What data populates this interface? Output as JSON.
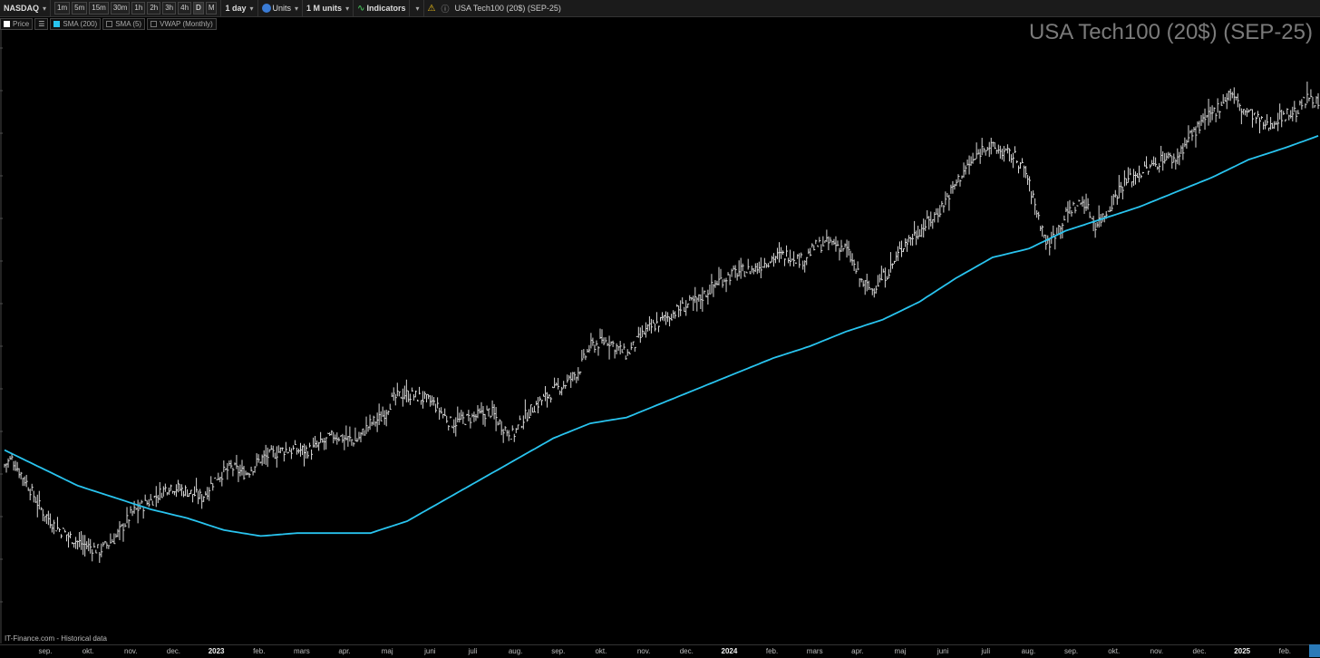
{
  "toolbar": {
    "exchange": "NASDAQ",
    "intervals": [
      "1m",
      "5m",
      "15m",
      "30m",
      "1h",
      "2h",
      "3h",
      "4h",
      "D",
      "M"
    ],
    "active_interval": "D",
    "period": "1 day",
    "units_label": "Units",
    "m_units": "1 M units",
    "indicators": "Indicators",
    "warning_icon": "warning-icon",
    "info_icon": "info-icon",
    "instrument": "USA Tech100 (20$) (SEP-25)"
  },
  "legend": {
    "price": "Price",
    "sma200": "SMA (200)",
    "sma5": "SMA (5)",
    "vwap": "VWAP (Monthly)",
    "sma200_color": "#29c4ef"
  },
  "footer": "IT-Finance.com - Historical data",
  "chart_data": {
    "type": "line",
    "title": "USA Tech100 (20$) (SEP-25)",
    "x_months": [
      {
        "label": "sep."
      },
      {
        "label": "okt."
      },
      {
        "label": "nov."
      },
      {
        "label": "dec."
      },
      {
        "label": "2023",
        "year": true
      },
      {
        "label": "feb."
      },
      {
        "label": "mars"
      },
      {
        "label": "apr."
      },
      {
        "label": "maj"
      },
      {
        "label": "juni"
      },
      {
        "label": "juli"
      },
      {
        "label": "aug."
      },
      {
        "label": "sep."
      },
      {
        "label": "okt."
      },
      {
        "label": "nov."
      },
      {
        "label": "dec."
      },
      {
        "label": "2024",
        "year": true
      },
      {
        "label": "feb."
      },
      {
        "label": "mars"
      },
      {
        "label": "apr."
      },
      {
        "label": "maj"
      },
      {
        "label": "juni"
      },
      {
        "label": "juli"
      },
      {
        "label": "aug."
      },
      {
        "label": "sep."
      },
      {
        "label": "okt."
      },
      {
        "label": "nov."
      },
      {
        "label": "dec."
      },
      {
        "label": "2025",
        "year": true
      },
      {
        "label": "feb."
      }
    ],
    "price_range": [
      0,
      100
    ],
    "series": [
      {
        "name": "Price",
        "color": "#d8d8d8",
        "anchors": [
          [
            0,
            72
          ],
          [
            2,
            74
          ],
          [
            6,
            66
          ],
          [
            10,
            57
          ],
          [
            14,
            51
          ],
          [
            20,
            46
          ],
          [
            26,
            43
          ],
          [
            30,
            47
          ],
          [
            35,
            56
          ],
          [
            40,
            60
          ],
          [
            45,
            65
          ],
          [
            50,
            63
          ],
          [
            54,
            61
          ],
          [
            58,
            68
          ],
          [
            62,
            71
          ],
          [
            66,
            69
          ],
          [
            70,
            74
          ],
          [
            76,
            77
          ],
          [
            80,
            77
          ],
          [
            84,
            77
          ],
          [
            90,
            82
          ],
          [
            96,
            80
          ],
          [
            100,
            86
          ],
          [
            103,
            88
          ],
          [
            106,
            94
          ],
          [
            109,
            96
          ],
          [
            113,
            95
          ],
          [
            117,
            93
          ],
          [
            122,
            86
          ],
          [
            128,
            88
          ],
          [
            133,
            90
          ],
          [
            136,
            85
          ],
          [
            139,
            82
          ],
          [
            142,
            88
          ],
          [
            145,
            92
          ],
          [
            149,
            96
          ],
          [
            154,
            100
          ],
          [
            157,
            104
          ],
          [
            160,
            112
          ],
          [
            165,
            114
          ],
          [
            170,
            109
          ],
          [
            175,
            117
          ],
          [
            180,
            121
          ],
          [
            185,
            125
          ],
          [
            190,
            128
          ],
          [
            195,
            134
          ],
          [
            200,
            137
          ],
          [
            205,
            138
          ],
          [
            210,
            142
          ],
          [
            214,
            143
          ],
          [
            218,
            141
          ],
          [
            222,
            146
          ],
          [
            226,
            147
          ],
          [
            230,
            145
          ],
          [
            234,
            134
          ],
          [
            237,
            131
          ],
          [
            242,
            138
          ],
          [
            246,
            147
          ],
          [
            250,
            151
          ],
          [
            255,
            157
          ],
          [
            258,
            163
          ],
          [
            262,
            171
          ],
          [
            265,
            175
          ],
          [
            268,
            180
          ],
          [
            272,
            178
          ],
          [
            276,
            176
          ],
          [
            279,
            171
          ],
          [
            282,
            158
          ],
          [
            285,
            146
          ],
          [
            288,
            152
          ],
          [
            291,
            158
          ],
          [
            295,
            161
          ],
          [
            298,
            153
          ],
          [
            301,
            157
          ],
          [
            305,
            166
          ],
          [
            309,
            170
          ],
          [
            313,
            172
          ],
          [
            317,
            176
          ],
          [
            320,
            175
          ],
          [
            324,
            183
          ],
          [
            328,
            188
          ],
          [
            332,
            193
          ],
          [
            335,
            198
          ],
          [
            338,
            192
          ],
          [
            341,
            190
          ],
          [
            345,
            186
          ],
          [
            349,
            190
          ],
          [
            353,
            191
          ],
          [
            357,
            197
          ],
          [
            359,
            193
          ]
        ]
      },
      {
        "name": "SMA (200)",
        "color": "#29c4ef",
        "anchors": [
          [
            0,
            77
          ],
          [
            10,
            71
          ],
          [
            20,
            65
          ],
          [
            30,
            61
          ],
          [
            40,
            57
          ],
          [
            50,
            54
          ],
          [
            60,
            50
          ],
          [
            70,
            48
          ],
          [
            80,
            49
          ],
          [
            90,
            49
          ],
          [
            100,
            49
          ],
          [
            110,
            53
          ],
          [
            120,
            60
          ],
          [
            130,
            67
          ],
          [
            140,
            74
          ],
          [
            150,
            81
          ],
          [
            160,
            86
          ],
          [
            170,
            88
          ],
          [
            180,
            93
          ],
          [
            190,
            98
          ],
          [
            200,
            103
          ],
          [
            210,
            108
          ],
          [
            220,
            112
          ],
          [
            230,
            117
          ],
          [
            240,
            121
          ],
          [
            250,
            127
          ],
          [
            260,
            135
          ],
          [
            270,
            142
          ],
          [
            280,
            145
          ],
          [
            290,
            151
          ],
          [
            300,
            155
          ],
          [
            310,
            159
          ],
          [
            320,
            164
          ],
          [
            330,
            169
          ],
          [
            340,
            175
          ],
          [
            350,
            179
          ],
          [
            359,
            183
          ]
        ]
      }
    ]
  }
}
